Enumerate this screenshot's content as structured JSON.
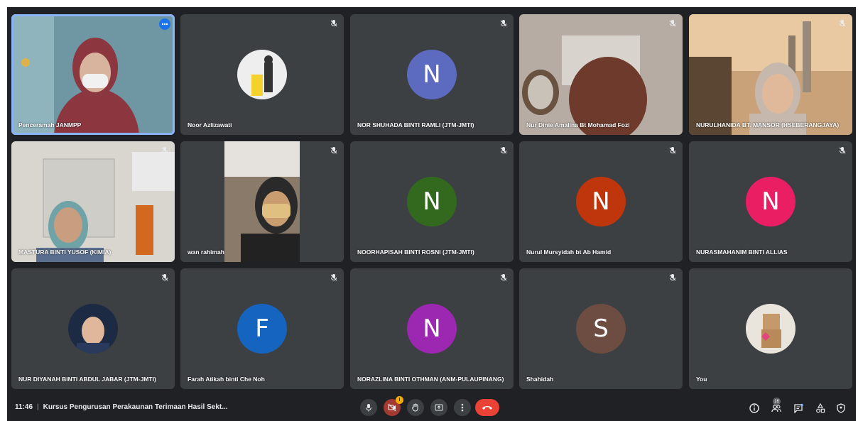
{
  "participants": [
    {
      "name": "Penceramah JANMPP",
      "type": "video",
      "active": true
    },
    {
      "name": "Noor Azlizawati",
      "type": "photo"
    },
    {
      "name": "NOR SHUHADA BINTI RAMLI (JTM-JMTI)",
      "type": "initial",
      "initial": "N",
      "color": "#5c6bc0"
    },
    {
      "name": "Nur Dinie Amalina Bt Mohamad Fozi",
      "type": "video"
    },
    {
      "name": "NURULHANIDA BT. MANSOR (HSEBERANGJAYA)",
      "type": "video"
    },
    {
      "name": "MASTURA BINTI YUSOF (KIMIA)",
      "type": "video"
    },
    {
      "name": "wan rahimah",
      "type": "video"
    },
    {
      "name": "NOORHAPISAH BINTI ROSNI (JTM-JMTI)",
      "type": "initial",
      "initial": "N",
      "color": "#33691e"
    },
    {
      "name": "Nurul Mursyidah bt Ab Hamid",
      "type": "initial",
      "initial": "N",
      "color": "#bf360c"
    },
    {
      "name": "NURASMAHANIM BINTI ALLIAS",
      "type": "initial",
      "initial": "N",
      "color": "#e91e63"
    },
    {
      "name": "NUR DIYANAH BINTI ABDUL JABAR (JTM-JMTI)",
      "type": "photo"
    },
    {
      "name": "Farah Atikah binti Che Noh",
      "type": "initial",
      "initial": "F",
      "color": "#1565c0"
    },
    {
      "name": "NORAZLINA BINTI OTHMAN (ANM-PULAUPINANG)",
      "type": "initial",
      "initial": "N",
      "color": "#9c27b0"
    },
    {
      "name": "Shahidah",
      "type": "initial",
      "initial": "S",
      "color": "#6d4c41"
    },
    {
      "name": "You",
      "type": "photo"
    }
  ],
  "bottom_bar": {
    "time": "11:46",
    "separator": "|",
    "meeting_title": "Kursus Pengurusan Perakaunan Terimaan Hasil Sekt...",
    "camera_badge": "!",
    "people_count": "16"
  },
  "colors": {
    "background": "#202124",
    "tile": "#3c4043",
    "hangup": "#ea4335",
    "active_outline": "#8ab4f8"
  }
}
